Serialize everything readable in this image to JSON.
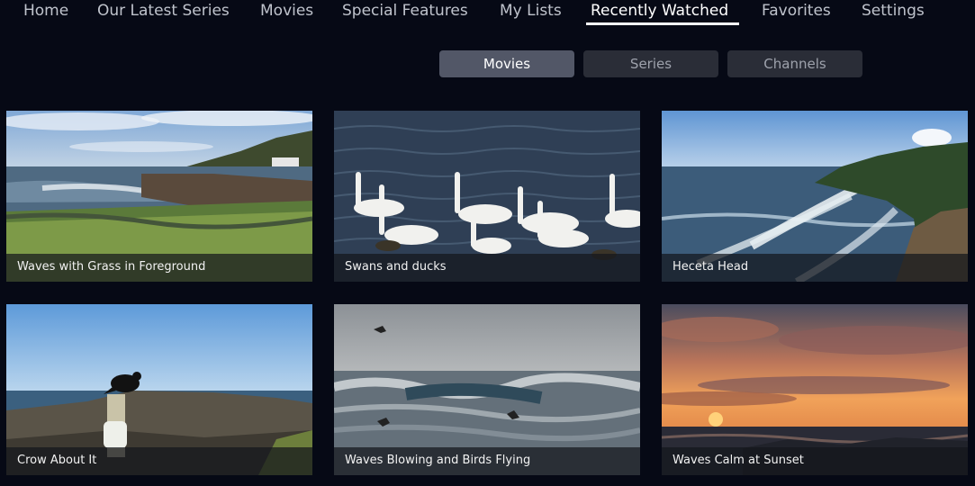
{
  "nav": {
    "items": [
      {
        "label": "Home"
      },
      {
        "label": "Our Latest Series"
      },
      {
        "label": "Movies"
      },
      {
        "label": "Special Features"
      },
      {
        "label": "My Lists"
      },
      {
        "label": "Recently Watched",
        "active": true
      },
      {
        "label": "Favorites"
      },
      {
        "label": "Settings"
      }
    ]
  },
  "filters": {
    "items": [
      {
        "label": "Movies",
        "active": true
      },
      {
        "label": "Series"
      },
      {
        "label": "Channels"
      }
    ]
  },
  "grid": {
    "items": [
      {
        "title": "Waves with Grass in Foreground"
      },
      {
        "title": "Swans and ducks"
      },
      {
        "title": "Heceta Head"
      },
      {
        "title": "Crow About It"
      },
      {
        "title": "Waves Blowing and Birds Flying"
      },
      {
        "title": "Waves Calm at Sunset"
      }
    ]
  }
}
